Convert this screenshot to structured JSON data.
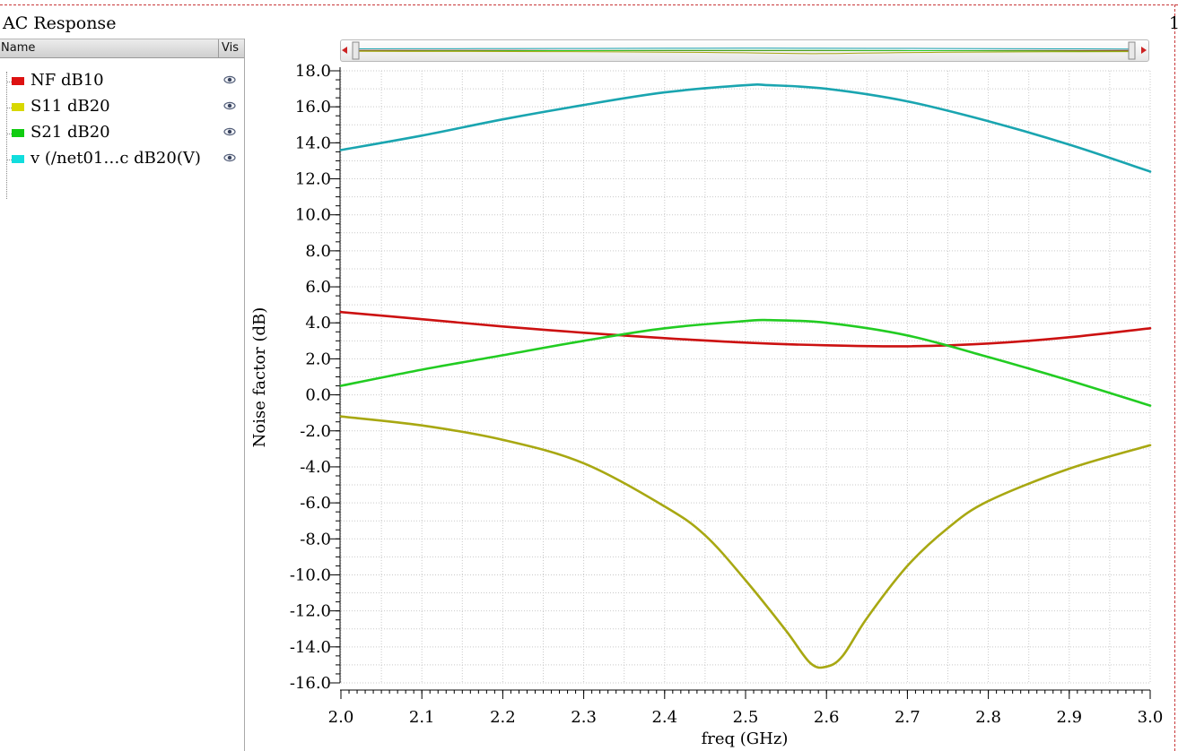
{
  "window": {
    "title": "AC Response",
    "corner_label": "1"
  },
  "legend": {
    "header_name": "Name",
    "header_vis": "Vis",
    "items": [
      {
        "label": "NF dB10",
        "color": "#dd1111"
      },
      {
        "label": "S11 dB20",
        "color": "#d8d800"
      },
      {
        "label": "S21 dB20",
        "color": "#11cc11"
      },
      {
        "label": "v (/net01…c dB20(V)",
        "color": "#11dddd"
      }
    ]
  },
  "icons": {
    "visibility": "eye-icon",
    "scroll_left": "arrow-left-icon",
    "scroll_right": "arrow-right-icon",
    "scroll_grip": "grip-icon"
  },
  "chart_data": {
    "type": "line",
    "xlabel": "freq (GHz)",
    "ylabel": "Noise factor (dB)",
    "xlim": [
      2.0,
      3.0
    ],
    "ylim": [
      -16.0,
      18.0
    ],
    "x_ticks": [
      2.0,
      2.1,
      2.2,
      2.3,
      2.4,
      2.5,
      2.6,
      2.7,
      2.8,
      2.9,
      3.0
    ],
    "x_tick_labels": [
      "2.0",
      "2.1",
      "2.2",
      "2.3",
      "2.4",
      "2.5",
      "2.6",
      "2.7",
      "2.8",
      "2.9",
      "3.0"
    ],
    "y_ticks": [
      18,
      16,
      14,
      12,
      10,
      8,
      6,
      4,
      2,
      0,
      -2,
      -4,
      -6,
      -8,
      -10,
      -12,
      -14,
      -16
    ],
    "y_tick_labels": [
      "18.0",
      "16.0",
      "14.0",
      "12.0",
      "10.0",
      "8.0",
      "6.0",
      "4.0",
      "2.0",
      "0.0",
      "-2.0",
      "-4.0",
      "-6.0",
      "-8.0",
      "-10.0",
      "-12.0",
      "-14.0",
      "-16.0"
    ],
    "grid": true,
    "series": [
      {
        "name": "v (/net01…c dB20(V)",
        "color": "#1aa5b0",
        "x": [
          2.0,
          2.1,
          2.2,
          2.3,
          2.4,
          2.5,
          2.53,
          2.6,
          2.7,
          2.8,
          2.9,
          3.0
        ],
        "y": [
          13.6,
          14.4,
          15.3,
          16.1,
          16.8,
          17.2,
          17.2,
          17.0,
          16.3,
          15.2,
          13.9,
          12.4
        ]
      },
      {
        "name": "NF dB10",
        "color": "#cc1111",
        "x": [
          2.0,
          2.1,
          2.2,
          2.3,
          2.4,
          2.5,
          2.6,
          2.7,
          2.8,
          2.9,
          3.0
        ],
        "y": [
          4.6,
          4.2,
          3.8,
          3.45,
          3.15,
          2.9,
          2.75,
          2.7,
          2.85,
          3.2,
          3.7
        ]
      },
      {
        "name": "S21 dB20",
        "color": "#22cc22",
        "x": [
          2.0,
          2.1,
          2.2,
          2.3,
          2.4,
          2.5,
          2.53,
          2.6,
          2.7,
          2.8,
          2.9,
          3.0
        ],
        "y": [
          0.5,
          1.4,
          2.2,
          3.0,
          3.7,
          4.1,
          4.15,
          4.0,
          3.3,
          2.1,
          0.8,
          -0.6
        ]
      },
      {
        "name": "S11 dB20",
        "color": "#a8a812",
        "x": [
          2.0,
          2.1,
          2.2,
          2.3,
          2.4,
          2.45,
          2.5,
          2.55,
          2.58,
          2.6,
          2.62,
          2.65,
          2.7,
          2.75,
          2.8,
          2.9,
          3.0
        ],
        "y": [
          -1.2,
          -1.7,
          -2.5,
          -3.8,
          -6.2,
          -7.8,
          -10.3,
          -13.1,
          -14.9,
          -15.1,
          -14.5,
          -12.4,
          -9.5,
          -7.4,
          -5.9,
          -4.1,
          -2.8
        ]
      }
    ]
  }
}
